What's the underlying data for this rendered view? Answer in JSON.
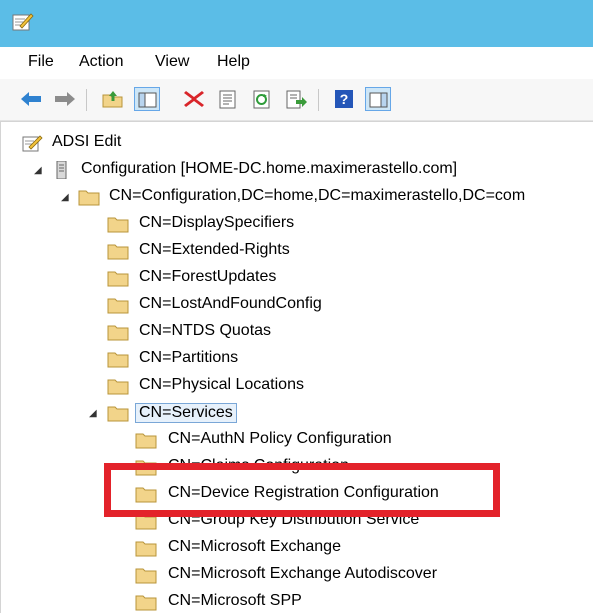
{
  "menu": {
    "file": "File",
    "action": "Action",
    "view": "View",
    "help": "Help"
  },
  "toolbar": {
    "buttons": [
      "back-arrow-icon",
      "forward-arrow-icon",
      "up-folder-icon",
      "show-hide-tree-icon",
      "delete-icon",
      "properties-icon",
      "refresh-icon",
      "export-list-icon",
      "help-icon",
      "show-hide-action-pane-icon"
    ]
  },
  "tree": {
    "root": "ADSI Edit",
    "configuration": "Configuration [HOME-DC.home.maximerastello.com]",
    "configuration_cn": "CN=Configuration,DC=home,DC=maximerastello,DC=com",
    "level2": [
      "CN=DisplaySpecifiers",
      "CN=Extended-Rights",
      "CN=ForestUpdates",
      "CN=LostAndFoundConfig",
      "CN=NTDS Quotas",
      "CN=Partitions",
      "CN=Physical Locations"
    ],
    "services": "CN=Services",
    "services_children": [
      "CN=AuthN Policy Configuration",
      "CN=Claims Configuration",
      "CN=Device Registration Configuration",
      "CN=Group Key Distribution Service",
      "CN=Microsoft Exchange",
      "CN=Microsoft Exchange Autodiscover",
      "CN=Microsoft SPP"
    ]
  },
  "colors": {
    "titlebar": "#5bbde7",
    "highlight_box": "#e3222a",
    "folder": "#f2d48a"
  }
}
